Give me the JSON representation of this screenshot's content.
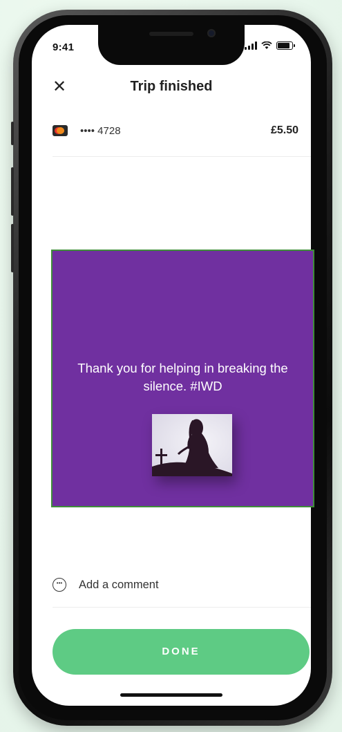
{
  "status_bar": {
    "time": "9:41"
  },
  "header": {
    "close_icon": "✕",
    "title": "Trip finished"
  },
  "payment": {
    "card_icon": "mastercard-icon",
    "card_number": "•••• 4728",
    "amount": "£5.50"
  },
  "overlay": {
    "background": "#7030a0",
    "message": "Thank you for helping in breaking the silence. #IWD",
    "image": "silhouette-woman-grave"
  },
  "comment": {
    "label": "Add a comment",
    "icon": "chat-bubble-icon"
  },
  "done_button": {
    "label": "DONE",
    "color": "#5ecb84"
  }
}
